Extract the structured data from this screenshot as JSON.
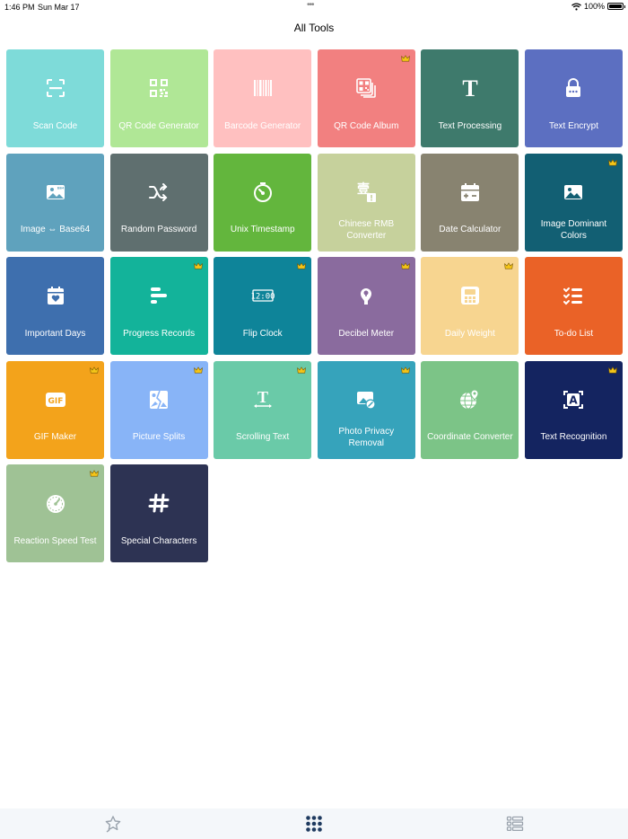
{
  "status_bar": {
    "time": "1:46 PM",
    "date": "Sun Mar 17",
    "battery": "100%"
  },
  "header": {
    "title": "All Tools"
  },
  "tools": [
    {
      "label": "Scan Code",
      "icon": "scan-code-icon",
      "color": "#7edbd9",
      "crown": false
    },
    {
      "label": "QR Code Generator",
      "icon": "qr-code-icon",
      "color": "#b0e796",
      "crown": false
    },
    {
      "label": "Barcode Generator",
      "icon": "barcode-icon",
      "color": "#ffc0c0",
      "crown": false
    },
    {
      "label": "QR Code Album",
      "icon": "qr-album-icon",
      "color": "#f28080",
      "crown": true
    },
    {
      "label": "Text Processing",
      "icon": "text-t-icon",
      "color": "#3e7a6c",
      "crown": false
    },
    {
      "label": "Text Encrypt",
      "icon": "lock-icon",
      "color": "#5c6fc1",
      "crown": false
    },
    {
      "label": "Image ⇔ Base64",
      "icon": "image-base64-icon",
      "color": "#5fa2bd",
      "crown": false
    },
    {
      "label": "Random Password",
      "icon": "shuffle-icon",
      "color": "#5f6f6f",
      "crown": false
    },
    {
      "label": "Unix Timestamp",
      "icon": "timer-icon",
      "color": "#63b63d",
      "crown": false
    },
    {
      "label": "Chinese RMB Converter",
      "icon": "rmb-icon",
      "color": "#c6d19c",
      "crown": false
    },
    {
      "label": "Date Calculator",
      "icon": "calendar-calc-icon",
      "color": "#888370",
      "crown": false
    },
    {
      "label": "Image Dominant Colors",
      "icon": "image-colors-icon",
      "color": "#125f73",
      "crown": true
    },
    {
      "label": "Important Days",
      "icon": "calendar-heart-icon",
      "color": "#3e6fae",
      "crown": false
    },
    {
      "label": "Progress Records",
      "icon": "progress-bars-icon",
      "color": "#13b39a",
      "crown": true
    },
    {
      "label": "Flip Clock",
      "icon": "clock-display-icon",
      "color": "#0e8499",
      "crown": true
    },
    {
      "label": "Decibel Meter",
      "icon": "decibel-icon",
      "color": "#8a6b9e",
      "crown": true
    },
    {
      "label": "Daily Weight",
      "icon": "scale-icon",
      "color": "#f7d590",
      "crown": true
    },
    {
      "label": "To-do List",
      "icon": "checklist-icon",
      "color": "#ea6227",
      "crown": false
    },
    {
      "label": "GIF Maker",
      "icon": "gif-icon",
      "color": "#f3a31b",
      "crown": true
    },
    {
      "label": "Picture Splits",
      "icon": "picture-split-icon",
      "color": "#88b4f7",
      "crown": true
    },
    {
      "label": "Scrolling Text",
      "icon": "scrolling-text-icon",
      "color": "#6acaa8",
      "crown": true
    },
    {
      "label": "Photo Privacy Removal",
      "icon": "photo-privacy-icon",
      "color": "#36a3bb",
      "crown": true
    },
    {
      "label": "Coordinate Converter",
      "icon": "globe-pin-icon",
      "color": "#7cc487",
      "crown": false
    },
    {
      "label": "Text Recognition",
      "icon": "text-recognition-icon",
      "color": "#142460",
      "crown": true
    },
    {
      "label": "Reaction Speed Test",
      "icon": "speed-dial-icon",
      "color": "#9fc295",
      "crown": true
    },
    {
      "label": "Special Characters",
      "icon": "hash-icon",
      "color": "#2d3353",
      "crown": false
    }
  ],
  "tab_bar": {
    "tabs": [
      {
        "icon": "favorites-star-icon",
        "active": false
      },
      {
        "icon": "all-tools-grid-icon",
        "active": true
      },
      {
        "icon": "list-icon",
        "active": false
      }
    ],
    "active_color": "#1e3a5f",
    "inactive_color": "#9aa3ad"
  }
}
